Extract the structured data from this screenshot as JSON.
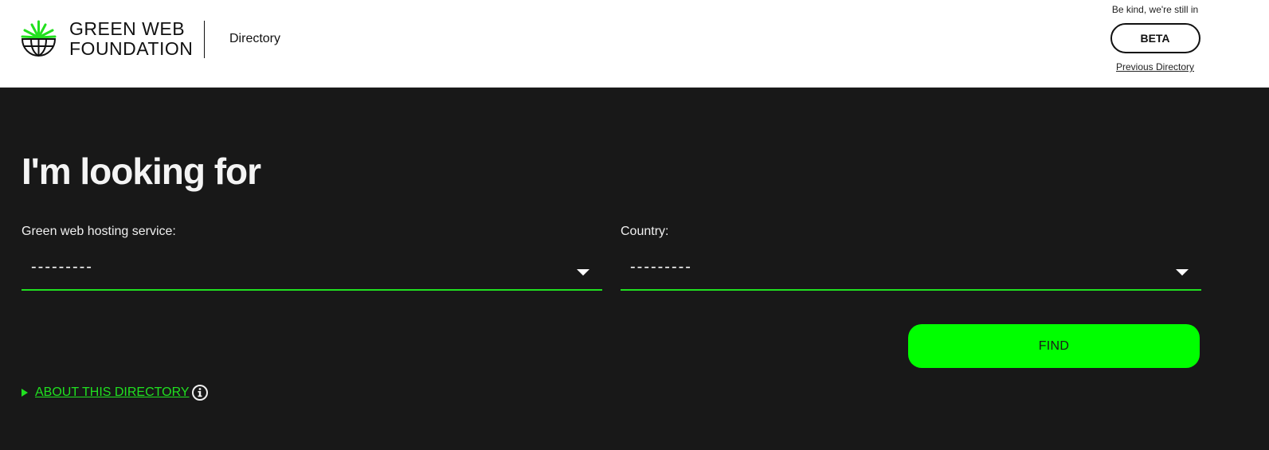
{
  "header": {
    "logo_line1": "GREEN WEB",
    "logo_line2": "FOUNDATION",
    "directory_label": "Directory",
    "beta_note": "Be kind, we're still in",
    "beta_label": "BETA",
    "previous_directory": "Previous Directory"
  },
  "main": {
    "title": "I'm looking for",
    "hosting_label": "Green web hosting service:",
    "hosting_value": "---------",
    "country_label": "Country:",
    "country_value": "---------",
    "find_label": "FIND",
    "about_label": "ABOUT THIS DIRECTORY"
  },
  "colors": {
    "accent": "#00ff00",
    "background": "#181818",
    "header_bg": "#ffffff"
  },
  "icons": [
    "globe-logo-icon",
    "chevron-down-icon",
    "disclosure-triangle-icon",
    "info-icon"
  ]
}
